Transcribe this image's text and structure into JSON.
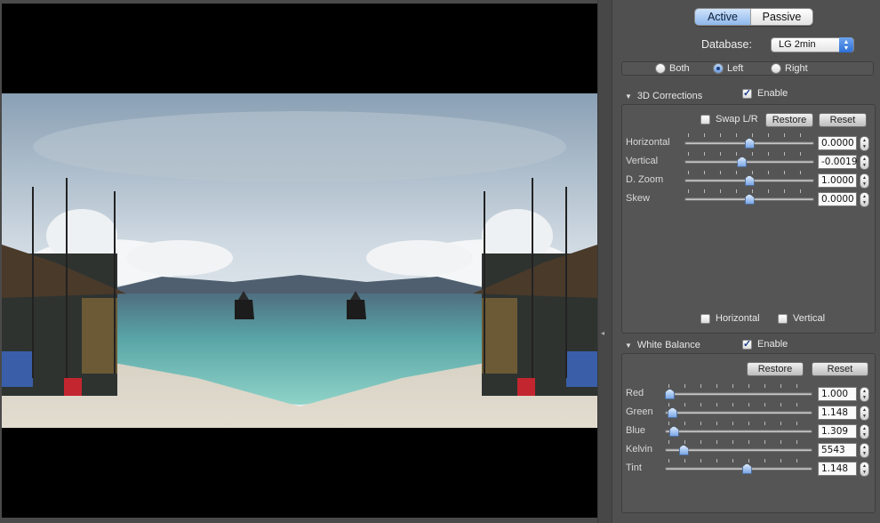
{
  "mode_tabs": {
    "active": "Active",
    "passive": "Passive"
  },
  "database": {
    "label": "Database:",
    "value": "LG 2min"
  },
  "eye_select": {
    "both": "Both",
    "left": "Left",
    "right": "Right",
    "selected": "Left"
  },
  "corrections_3d": {
    "title": "3D Corrections",
    "enable_label": "Enable",
    "enabled": true,
    "swap_label": "Swap L/R",
    "restore_label": "Restore",
    "reset_label": "Reset",
    "sliders": [
      {
        "label": "Horizontal",
        "value": "0.0000",
        "level": 0.5
      },
      {
        "label": "Vertical",
        "value": "-0.0019",
        "level": 0.44
      },
      {
        "label": "D. Zoom",
        "value": "1.0000",
        "level": 0.5
      },
      {
        "label": "Skew",
        "value": "0.0000",
        "level": 0.5
      }
    ],
    "flip_horizontal_label": "Horizontal",
    "flip_vertical_label": "Vertical"
  },
  "white_balance": {
    "title": "White Balance",
    "enable_label": "Enable",
    "enabled": true,
    "restore_label": "Restore",
    "reset_label": "Reset",
    "sliders": [
      {
        "label": "Red",
        "value": "1.000",
        "level": 0.0
      },
      {
        "label": "Green",
        "value": "1.148",
        "level": 0.02
      },
      {
        "label": "Blue",
        "value": "1.309",
        "level": 0.03
      },
      {
        "label": "Kelvin",
        "value": "5543",
        "level": 0.1
      },
      {
        "label": "Tint",
        "value": "1.148",
        "level": 0.56
      }
    ]
  }
}
